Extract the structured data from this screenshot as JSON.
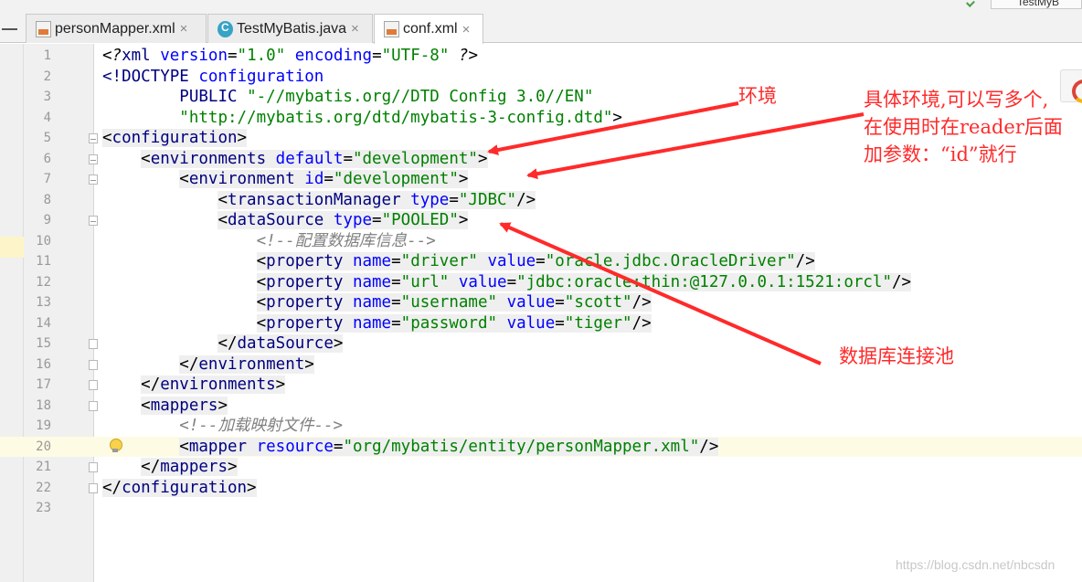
{
  "tabs": [
    {
      "label": "personMapper.xml",
      "icon": "xml-file-icon",
      "active": false
    },
    {
      "label": "TestMyBatis.java",
      "icon": "java-class-icon",
      "active": false
    },
    {
      "label": "conf.xml",
      "icon": "xml-file-icon",
      "active": true
    }
  ],
  "right_tab_label": "TestMyB",
  "close_glyph": "×",
  "current_line": 20,
  "code_lines": [
    {
      "n": "1",
      "tokens": [
        [
          "t",
          "<?"
        ],
        [
          "n",
          "xml "
        ],
        [
          "a",
          "version"
        ],
        [
          "p",
          "="
        ],
        [
          "v",
          "\"1.0\" "
        ],
        [
          "a",
          "encoding"
        ],
        [
          "p",
          "="
        ],
        [
          "v",
          "\"UTF-8\" "
        ],
        [
          "t",
          "?>"
        ]
      ]
    },
    {
      "n": "2",
      "tokens": [
        [
          "n",
          "<!DOCTYPE "
        ],
        [
          "a",
          "configuration"
        ]
      ]
    },
    {
      "n": "3",
      "tokens": [
        [
          "p",
          "        "
        ],
        [
          "n",
          "PUBLIC "
        ],
        [
          "v",
          "\"-//mybatis.org//DTD Config 3.0//EN\""
        ]
      ]
    },
    {
      "n": "4",
      "tokens": [
        [
          "p",
          "        "
        ],
        [
          "v",
          "\"http://mybatis.org/dtd/mybatis-3-config.dtd\""
        ],
        [
          "p",
          ">"
        ]
      ]
    },
    {
      "n": "5",
      "tokens": [
        [
          "g",
          "<"
        ],
        [
          "gn",
          "configuration"
        ],
        [
          "g",
          ">"
        ]
      ]
    },
    {
      "n": "6",
      "tokens": [
        [
          "p",
          "    "
        ],
        [
          "g",
          "<"
        ],
        [
          "gn",
          "environments "
        ],
        [
          "ga",
          "default"
        ],
        [
          "g",
          "="
        ],
        [
          "gv",
          "\"development\""
        ],
        [
          "g",
          ">"
        ]
      ]
    },
    {
      "n": "7",
      "tokens": [
        [
          "p",
          "        "
        ],
        [
          "g",
          "<"
        ],
        [
          "gn",
          "environment "
        ],
        [
          "ga",
          "id"
        ],
        [
          "g",
          "="
        ],
        [
          "gv",
          "\"development\""
        ],
        [
          "g",
          ">"
        ]
      ]
    },
    {
      "n": "8",
      "tokens": [
        [
          "p",
          "            "
        ],
        [
          "g",
          "<"
        ],
        [
          "gn",
          "transactionManager "
        ],
        [
          "ga",
          "type"
        ],
        [
          "g",
          "="
        ],
        [
          "gv",
          "\"JDBC\""
        ],
        [
          "g",
          "/>"
        ]
      ]
    },
    {
      "n": "9",
      "tokens": [
        [
          "p",
          "            "
        ],
        [
          "g",
          "<"
        ],
        [
          "gn",
          "dataSource "
        ],
        [
          "ga",
          "type"
        ],
        [
          "g",
          "="
        ],
        [
          "gv",
          "\"POOLED\""
        ],
        [
          "g",
          ">"
        ]
      ]
    },
    {
      "n": "10",
      "tokens": [
        [
          "p",
          "                "
        ],
        [
          "c",
          "<!--配置数据库信息-->"
        ]
      ]
    },
    {
      "n": "11",
      "tokens": [
        [
          "p",
          "                "
        ],
        [
          "g",
          "<"
        ],
        [
          "gn",
          "property "
        ],
        [
          "ga",
          "name"
        ],
        [
          "g",
          "="
        ],
        [
          "gv",
          "\"driver\" "
        ],
        [
          "ga",
          "value"
        ],
        [
          "g",
          "="
        ],
        [
          "gv",
          "\"oracle.jdbc.OracleDriver\""
        ],
        [
          "g",
          "/>"
        ]
      ]
    },
    {
      "n": "12",
      "tokens": [
        [
          "p",
          "                "
        ],
        [
          "g",
          "<"
        ],
        [
          "gn",
          "property "
        ],
        [
          "ga",
          "name"
        ],
        [
          "g",
          "="
        ],
        [
          "gv",
          "\"url\" "
        ],
        [
          "ga",
          "value"
        ],
        [
          "g",
          "="
        ],
        [
          "gv",
          "\"jdbc:oracle:thin:@127.0.0.1:1521:orcl\""
        ],
        [
          "g",
          "/>"
        ]
      ]
    },
    {
      "n": "13",
      "tokens": [
        [
          "p",
          "                "
        ],
        [
          "g",
          "<"
        ],
        [
          "gn",
          "property "
        ],
        [
          "ga",
          "name"
        ],
        [
          "g",
          "="
        ],
        [
          "gv",
          "\"username\" "
        ],
        [
          "ga",
          "value"
        ],
        [
          "g",
          "="
        ],
        [
          "gv",
          "\"scott\""
        ],
        [
          "g",
          "/>"
        ]
      ]
    },
    {
      "n": "14",
      "tokens": [
        [
          "p",
          "                "
        ],
        [
          "g",
          "<"
        ],
        [
          "gn",
          "property "
        ],
        [
          "ga",
          "name"
        ],
        [
          "g",
          "="
        ],
        [
          "gv",
          "\"password\" "
        ],
        [
          "ga",
          "value"
        ],
        [
          "g",
          "="
        ],
        [
          "gv",
          "\"tiger\""
        ],
        [
          "g",
          "/>"
        ]
      ]
    },
    {
      "n": "15",
      "tokens": [
        [
          "p",
          "            "
        ],
        [
          "g",
          "</"
        ],
        [
          "gn",
          "dataSource"
        ],
        [
          "g",
          ">"
        ]
      ]
    },
    {
      "n": "16",
      "tokens": [
        [
          "p",
          "        "
        ],
        [
          "g",
          "</"
        ],
        [
          "gn",
          "environment"
        ],
        [
          "g",
          ">"
        ]
      ]
    },
    {
      "n": "17",
      "tokens": [
        [
          "p",
          "    "
        ],
        [
          "g",
          "</"
        ],
        [
          "gn",
          "environments"
        ],
        [
          "g",
          ">"
        ]
      ]
    },
    {
      "n": "18",
      "tokens": [
        [
          "p",
          "    "
        ],
        [
          "g",
          "<"
        ],
        [
          "gn",
          "mappers"
        ],
        [
          "g",
          ">"
        ]
      ]
    },
    {
      "n": "19",
      "tokens": [
        [
          "p",
          "        "
        ],
        [
          "c",
          "<!--加载映射文件-->"
        ]
      ]
    },
    {
      "n": "20",
      "tokens": [
        [
          "p",
          "        "
        ],
        [
          "g",
          "<"
        ],
        [
          "gn",
          "mapper "
        ],
        [
          "ga",
          "resource"
        ],
        [
          "g",
          "="
        ],
        [
          "gv",
          "\"org/mybatis/entity/personMapper.xml\""
        ],
        [
          "g",
          "/>"
        ]
      ]
    },
    {
      "n": "21",
      "tokens": [
        [
          "p",
          "    "
        ],
        [
          "g",
          "</"
        ],
        [
          "gn",
          "mappers"
        ],
        [
          "g",
          ">"
        ]
      ]
    },
    {
      "n": "22",
      "tokens": [
        [
          "g",
          "</"
        ],
        [
          "gn",
          "configuration"
        ],
        [
          "g",
          ">"
        ]
      ]
    },
    {
      "n": "23",
      "tokens": []
    }
  ],
  "fold_open_lines": [
    5,
    6,
    7,
    9
  ],
  "fold_close_lines": [
    15,
    16,
    17,
    18,
    21,
    22
  ],
  "annotations": {
    "env_label": "环境",
    "env_detail_1": "具体环境,可以写多个,",
    "env_detail_2": "在使用时在reader后面",
    "env_detail_3": "加参数：“id”就行",
    "pool_label": "数据库连接池"
  },
  "annotation_color": "#ff2a2a",
  "watermark": "https://blog.csdn.net/nbcsdn"
}
